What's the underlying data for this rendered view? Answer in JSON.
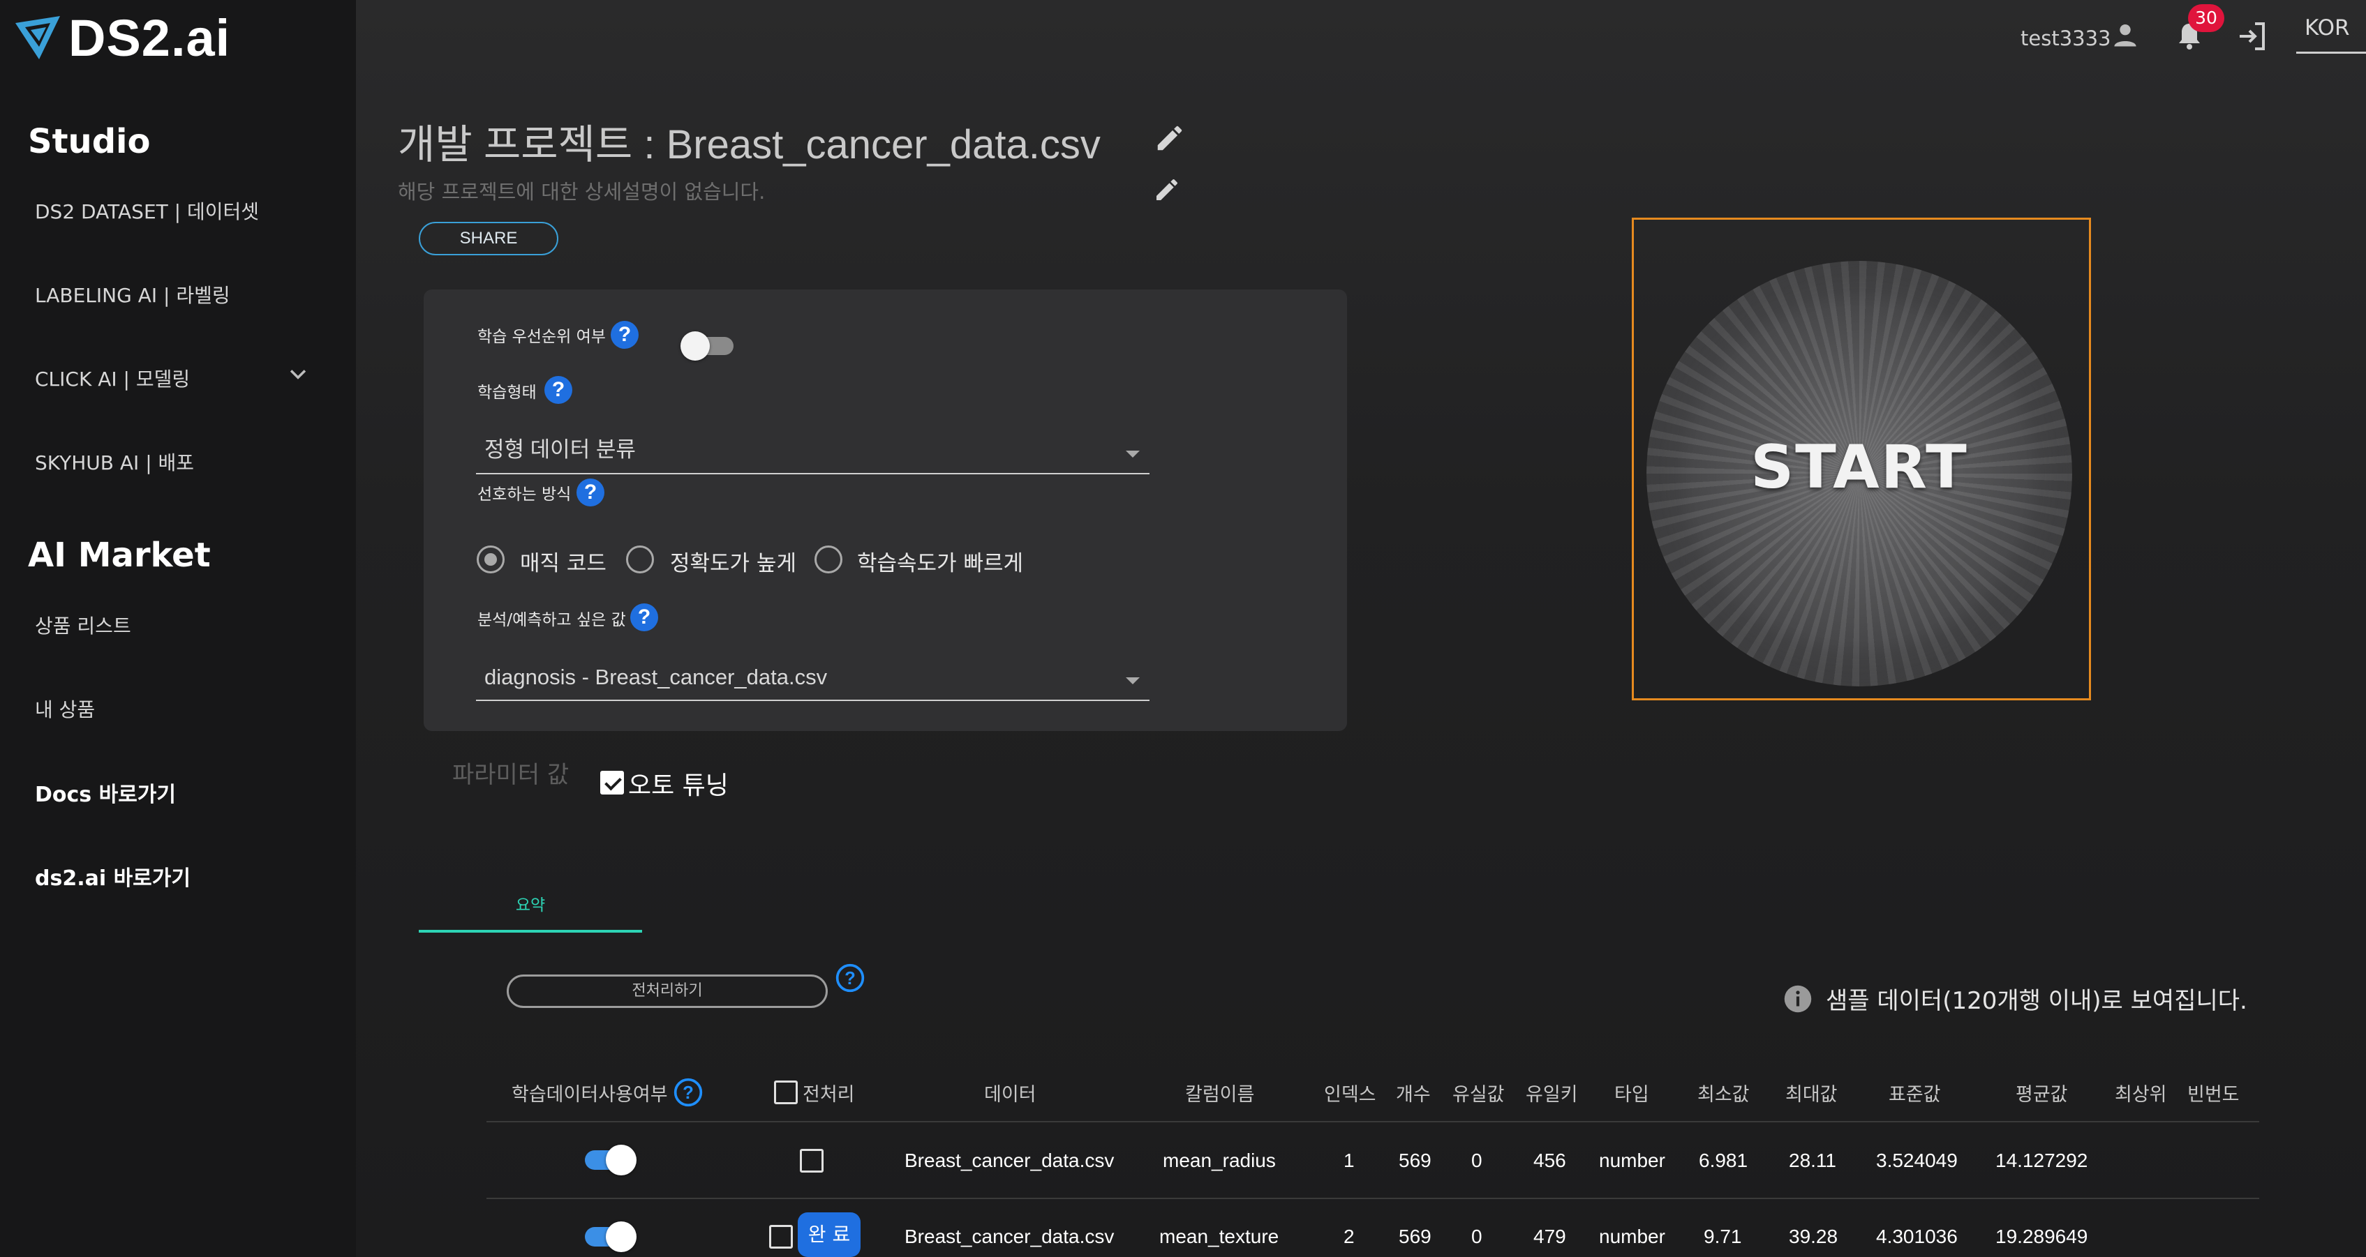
{
  "app": {
    "logo_text": "DS2.ai",
    "brand_color": "#3aa0d8"
  },
  "sidebar": {
    "studio_title": "Studio",
    "items": [
      {
        "label": "DS2 DATASET | 데이터셋"
      },
      {
        "label": "LABELING AI | 라벨링"
      },
      {
        "label": "CLICK AI | 모델링"
      },
      {
        "label": "SKYHUB AI | 배포"
      }
    ],
    "market_title": "AI Market",
    "market_items": [
      {
        "label": "상품 리스트"
      },
      {
        "label": "내 상품"
      }
    ],
    "links": [
      {
        "label": "Docs 바로가기"
      },
      {
        "label": "ds2.ai 바로가기"
      }
    ]
  },
  "header": {
    "username": "test3333",
    "notification_count": "30",
    "language": "KOR"
  },
  "project": {
    "title": "개발 프로젝트 : Breast_cancer_data.csv",
    "description": "해당 프로젝트에 대한 상세설명이 없습니다.",
    "share_label": "SHARE"
  },
  "settings": {
    "priority_label": "학습 우선순위 여부",
    "priority_enabled": false,
    "training_type_label": "학습형태",
    "training_type_value": "정형 데이터 분류",
    "preference_label": "선호하는 방식",
    "preference_options": [
      "매직 코드",
      "정확도가 높게",
      "학습속도가 빠르게"
    ],
    "preference_selected": "매직 코드",
    "target_label": "분석/예측하고 싶은 값",
    "target_value": "diagnosis - Breast_cancer_data.csv",
    "help_glyph": "?"
  },
  "params": {
    "label": "파라미터 값",
    "auto_tuning_label": "오토 튜닝",
    "auto_tuning_checked": true
  },
  "start": {
    "label": "START",
    "border_color": "#e68a1f"
  },
  "tabs": {
    "summary_label": "요약",
    "accent_color": "#2dd4b5"
  },
  "preprocess": {
    "button_label": "전처리하기",
    "sample_notice": "샘플 데이터(120개행 이내)로 보여집니다."
  },
  "table": {
    "headers": {
      "use": "학습데이터사용여부",
      "preprocess": "전처리",
      "data": "데이터",
      "column": "칼럼이름",
      "index": "인덱스",
      "count": "개수",
      "missing": "유실값",
      "unique": "유일키",
      "type": "타입",
      "min": "최소값",
      "max": "최대값",
      "std": "표준값",
      "mean": "평균값",
      "top": "최상위",
      "freq": "빈번도"
    },
    "done_label": "완 료",
    "rows": [
      {
        "data": "Breast_cancer_data.csv",
        "column": "mean_radius",
        "index": "1",
        "count": "569",
        "missing": "0",
        "unique": "456",
        "type": "number",
        "min": "6.981",
        "max": "28.11",
        "std": "3.524049",
        "mean": "14.127292"
      },
      {
        "data": "Breast_cancer_data.csv",
        "column": "mean_texture",
        "index": "2",
        "count": "569",
        "missing": "0",
        "unique": "479",
        "type": "number",
        "min": "9.71",
        "max": "39.28",
        "std": "4.301036",
        "mean": "19.289649"
      }
    ]
  }
}
